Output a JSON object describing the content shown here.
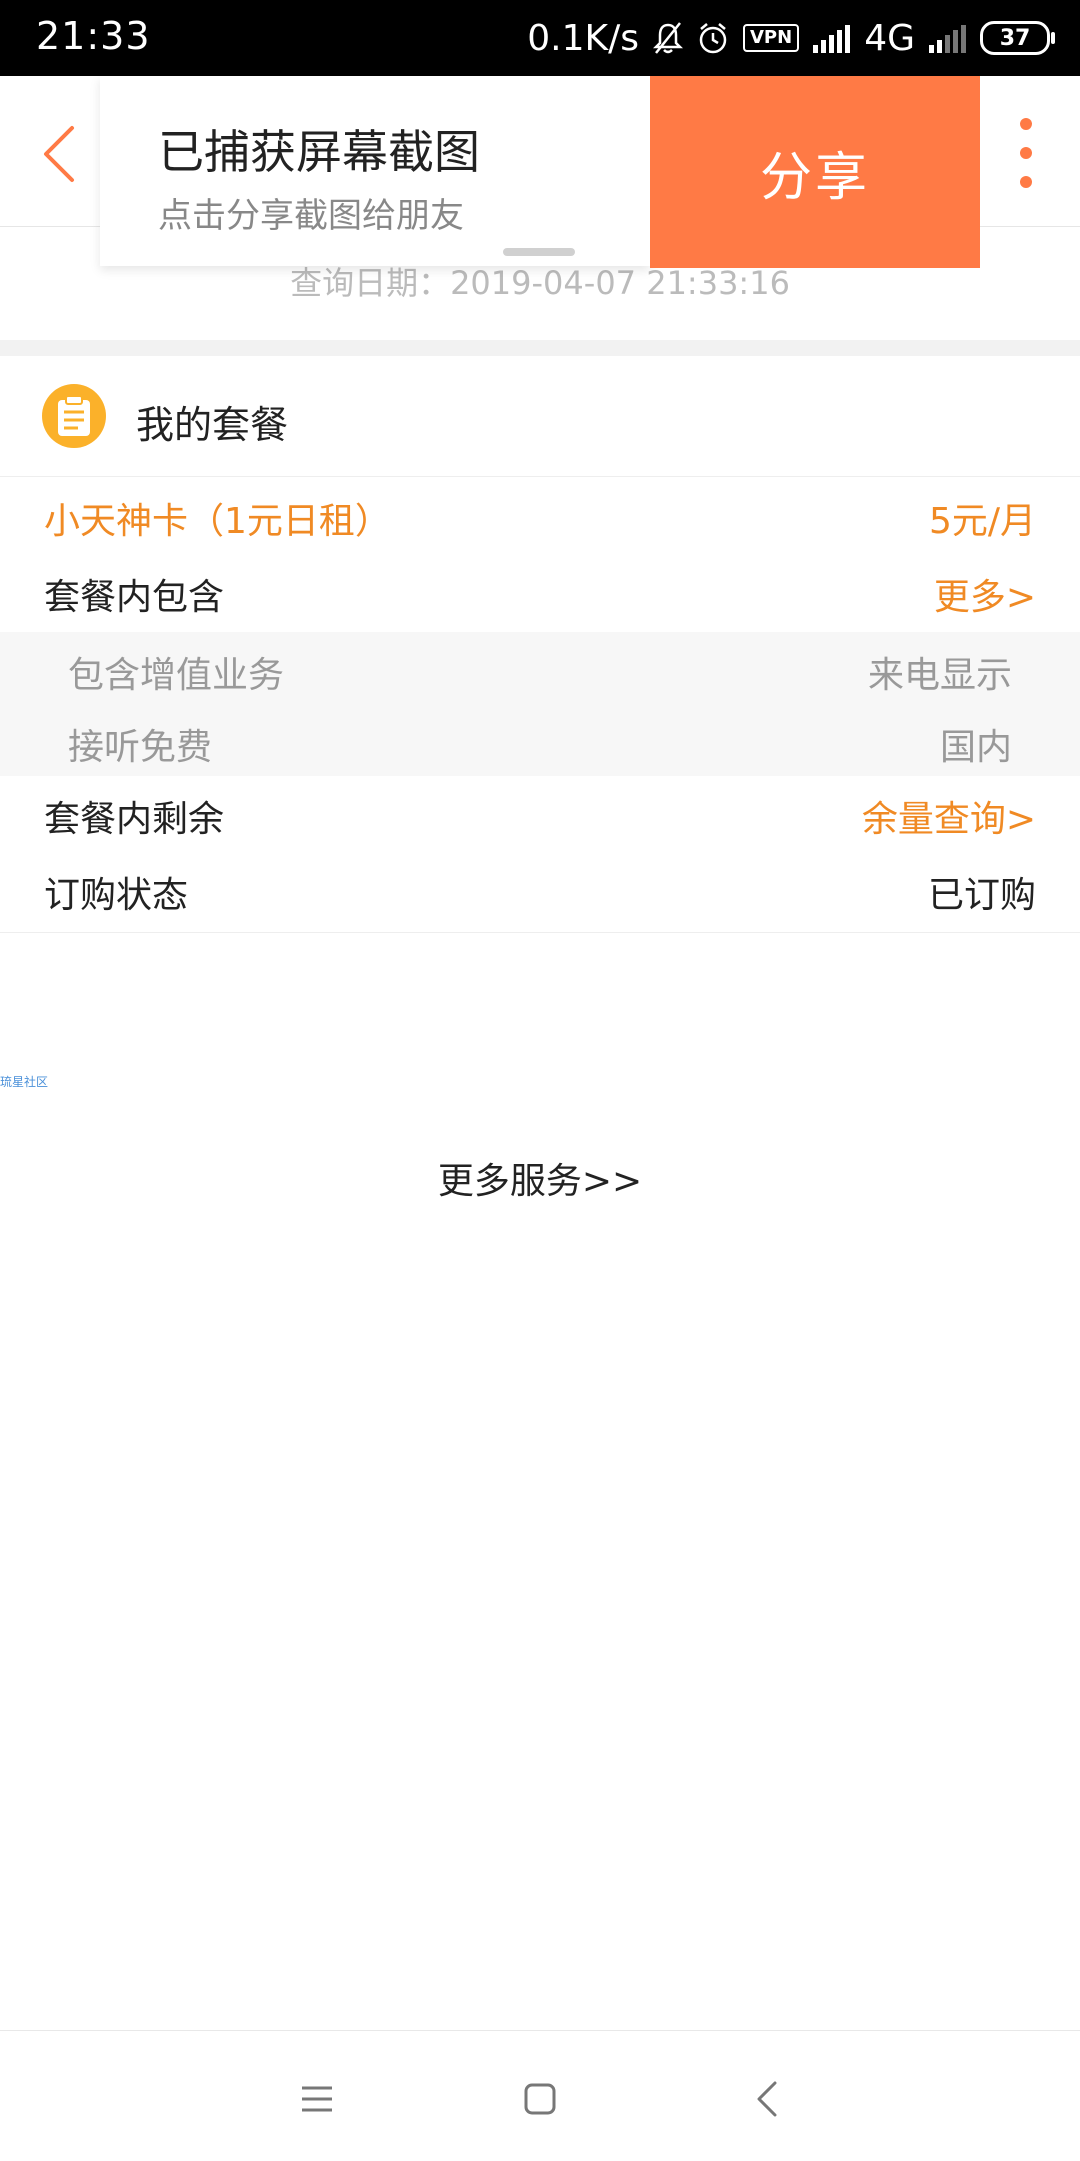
{
  "status_bar": {
    "time": "21:33",
    "speed": "0.1K/s",
    "vpn": "VPN",
    "network": "4G",
    "battery": "37"
  },
  "share_overlay": {
    "title": "已捕获屏幕截图",
    "subtitle": "点击分享截图给朋友",
    "share_label": "分享"
  },
  "query_date": "查询日期：2019-04-07 21:33:16",
  "package": {
    "section_title": "我的套餐",
    "name": "小天神卡（1元日租）",
    "price": "5元/月",
    "included_label": "套餐内包含",
    "included_more": "更多>",
    "items": [
      {
        "label": "包含增值业务",
        "value": "来电显示"
      },
      {
        "label": "接听免费",
        "value": "国内"
      }
    ],
    "remaining_label": "套餐内剩余",
    "remaining_link": "余量查询>",
    "status_label": "订购状态",
    "status_value": "已订购"
  },
  "tiny_link": "琉星社区",
  "more_services": "更多服务>>",
  "colors": {
    "accent": "#ff7a45",
    "orange_text": "#f08a24",
    "icon_bg": "#fbb12a"
  }
}
